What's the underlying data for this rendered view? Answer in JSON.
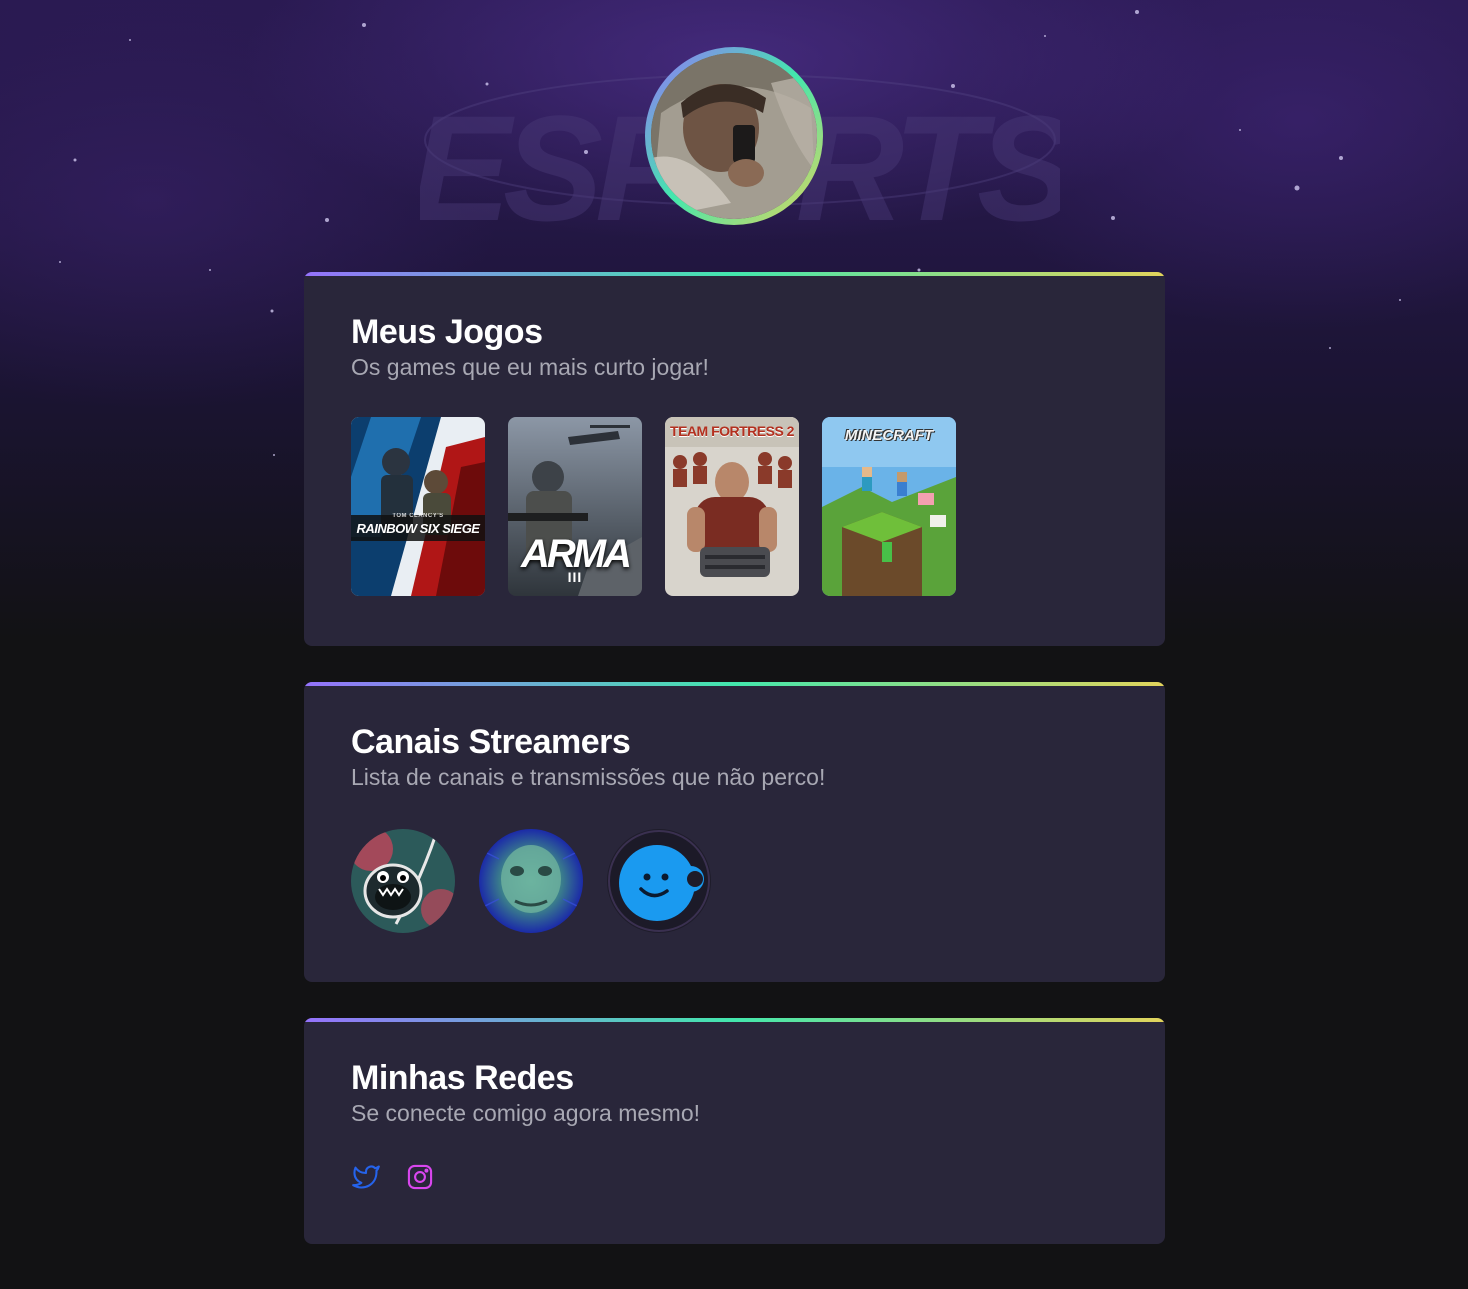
{
  "profile": {
    "avatar_icon": "profile-photo",
    "ring_colors": [
      "#9572fc",
      "#43e7ad",
      "#e2d45c"
    ]
  },
  "games_section": {
    "title": "Meus Jogos",
    "subtitle": "Os games que eu mais curto jogar!",
    "games": [
      {
        "name": "RAINBOW SIX SIEGE",
        "publisher": "TOM CLANCY'S"
      },
      {
        "name": "ARMA",
        "numeral": "III"
      },
      {
        "name": "TEAM FORTRESS 2"
      },
      {
        "name": "MINECRAFT"
      }
    ]
  },
  "streamers_section": {
    "title": "Canais Streamers",
    "subtitle": "Lista de canais e transmissões que não perco!",
    "channels": [
      {
        "icon": "monster-avatar-icon"
      },
      {
        "icon": "lizard-avatar-icon"
      },
      {
        "icon": "smiley-avatar-icon"
      }
    ]
  },
  "socials_section": {
    "title": "Minhas Redes",
    "subtitle": "Se conecte comigo agora mesmo!",
    "links": [
      {
        "icon": "twitter-icon",
        "color": "#1d4ed8"
      },
      {
        "icon": "instagram-icon",
        "color": "#d946ef"
      }
    ]
  },
  "theme": {
    "card_bg": "#29263a",
    "page_bg": "#121214",
    "subtitle_color": "#a8a8b3"
  }
}
